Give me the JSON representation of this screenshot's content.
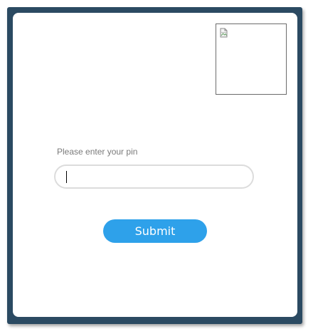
{
  "form": {
    "pin_label": "Please enter your pin",
    "pin_value": "",
    "pin_placeholder": "",
    "submit_label": "Submit"
  },
  "image": {
    "icon": "broken-image-icon"
  },
  "colors": {
    "frame": "#2b4a62",
    "accent": "#2ea1ea",
    "label": "#7a7a7a",
    "input_border": "#dcdcdc"
  }
}
